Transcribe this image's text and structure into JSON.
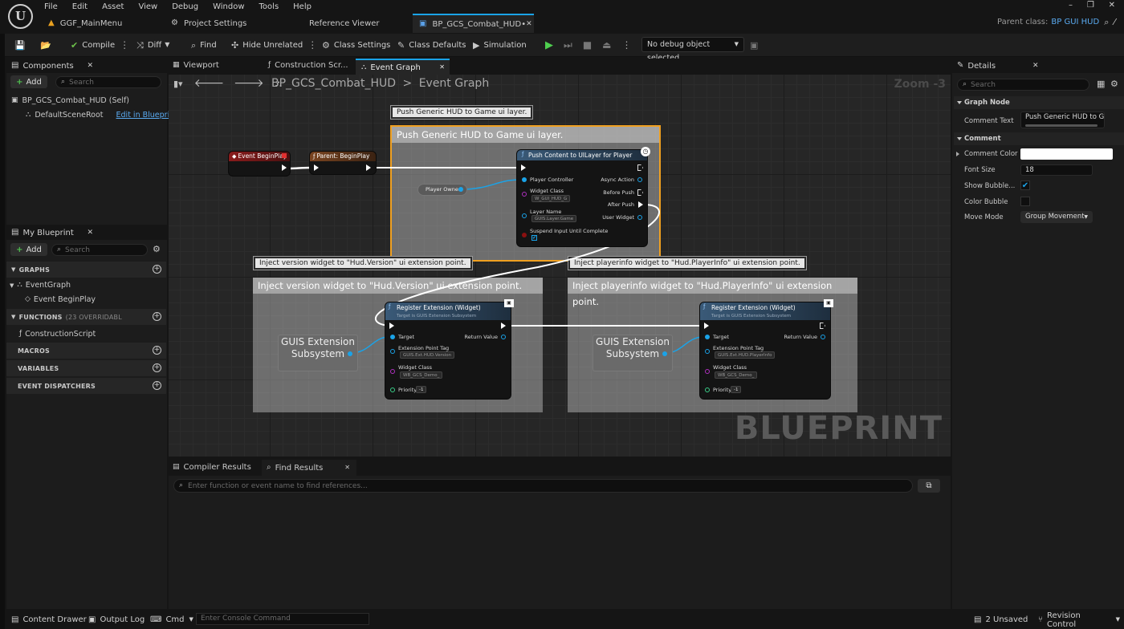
{
  "menu": [
    "File",
    "Edit",
    "Asset",
    "View",
    "Debug",
    "Window",
    "Tools",
    "Help"
  ],
  "doc_tabs": [
    {
      "label": "GGF_MainMenu",
      "icon": "warning-icon"
    },
    {
      "label": "Project Settings",
      "icon": "settings-icon"
    },
    {
      "label": "Reference Viewer",
      "icon": ""
    },
    {
      "label": "BP_GCS_Combat_HUD•",
      "icon": "blueprint-icon",
      "active": true
    }
  ],
  "parent_class": {
    "label": "Parent class:",
    "value": "BP GUI HUD"
  },
  "toolbar": {
    "compile": "Compile",
    "diff": "Diff",
    "find": "Find",
    "hide_unrelated": "Hide Unrelated",
    "class_settings": "Class Settings",
    "class_defaults": "Class Defaults",
    "simulation": "Simulation",
    "debug_object": "No debug object selected"
  },
  "components": {
    "title": "Components",
    "add": "Add",
    "search_placeholder": "Search",
    "items": [
      {
        "label": "BP_GCS_Combat_HUD (Self)"
      },
      {
        "label": "DefaultSceneRoot",
        "link": "Edit in Blueprint"
      }
    ]
  },
  "my_blueprint": {
    "title": "My Blueprint",
    "add": "Add",
    "search_placeholder": "Search",
    "graphs_label": "GRAPHS",
    "event_graph": "EventGraph",
    "event_begin_play": "Event BeginPlay",
    "functions_label": "FUNCTIONS",
    "functions_note": "(23 OVERRIDABL",
    "construction_script": "ConstructionScript",
    "macros_label": "MACROS",
    "variables_label": "VARIABLES",
    "dispatchers_label": "EVENT DISPATCHERS"
  },
  "editor_tabs": [
    {
      "label": "Viewport"
    },
    {
      "label": "Construction Scr..."
    },
    {
      "label": "Event Graph",
      "active": true
    }
  ],
  "breadcrumb": {
    "root": "BP_GCS_Combat_HUD",
    "separator": ">",
    "current": "Event Graph"
  },
  "zoom": "Zoom -3",
  "watermark": "BLUEPRINT",
  "graph": {
    "comment_push": {
      "bubble": "Push Generic HUD to Game ui layer.",
      "title": "Push Generic HUD to Game ui layer."
    },
    "comment_version": {
      "bubble": "Inject version widget to \"Hud.Version\" ui extension point.",
      "title": "Inject version widget to \"Hud.Version\" ui extension point."
    },
    "comment_playerinfo": {
      "bubble": "Inject playerinfo widget to \"Hud.PlayerInfo\" ui extension point.",
      "title": "Inject playerinfo widget to \"Hud.PlayerInfo\" ui extension point."
    },
    "event_begin_play": "Event BeginPlay",
    "parent_begin_play": "Parent: BeginPlay",
    "player_owner": "Player Owner",
    "push_node": {
      "title": "Push Content to UILayer for Player",
      "player_controller": "Player Controller",
      "widget_class": "Widget Class",
      "widget_class_value": "W_GUI_HUD_G",
      "layer_name": "Layer Name",
      "layer_name_value": "GUIS.Layer.Game",
      "suspend": "Suspend Input Until Complete",
      "async_action": "Async Action",
      "before_push": "Before Push",
      "after_push": "After Push",
      "user_widget": "User Widget"
    },
    "register_version": {
      "title": "Register Extension (Widget)",
      "subtitle": "Target is GUIS Extension Subsystem",
      "target": "Target",
      "return_value": "Return Value",
      "extension_point_tag": "Extension Point Tag",
      "tag_value": "GUIS.Ext.HUD.Version",
      "widget_class": "Widget Class",
      "widget_value": "WB_GCS_Demo_",
      "priority": "Priority",
      "priority_value": "-1"
    },
    "register_playerinfo": {
      "title": "Register Extension (Widget)",
      "subtitle": "Target is GUIS Extension Subsystem",
      "target": "Target",
      "return_value": "Return Value",
      "extension_point_tag": "Extension Point Tag",
      "tag_value": "GUIS.Ext.HUD.PlayerInfo",
      "widget_class": "Widget Class",
      "widget_value": "WB_GCS_Demo_",
      "priority": "Priority",
      "priority_value": "-1"
    },
    "guis_label": "GUIS Extension Subsystem"
  },
  "find_results": {
    "compiler_tab": "Compiler Results",
    "find_tab": "Find Results",
    "search_placeholder": "Enter function or event name to find references..."
  },
  "details": {
    "title": "Details",
    "search_placeholder": "Search",
    "graph_node_cat": "Graph Node",
    "comment_text_label": "Comment Text",
    "comment_text_value": "Push Generic HUD to Game",
    "comment_cat": "Comment",
    "comment_color_label": "Comment Color",
    "font_size_label": "Font Size",
    "font_size_value": "18",
    "show_bubble_label": "Show Bubble...",
    "color_bubble_label": "Color Bubble",
    "move_mode_label": "Move Mode",
    "move_mode_value": "Group Movement"
  },
  "statusbar": {
    "content_drawer": "Content Drawer",
    "output_log": "Output Log",
    "cmd": "Cmd",
    "console_placeholder": "Enter Console Command",
    "unsaved": "2 Unsaved",
    "revision_control": "Revision Control"
  },
  "colors": {
    "accent_blue": "#1aa3e8",
    "selection_orange": "#f0a020",
    "event_red": "#7a1a1a",
    "function_blue": "#3a5a78"
  }
}
